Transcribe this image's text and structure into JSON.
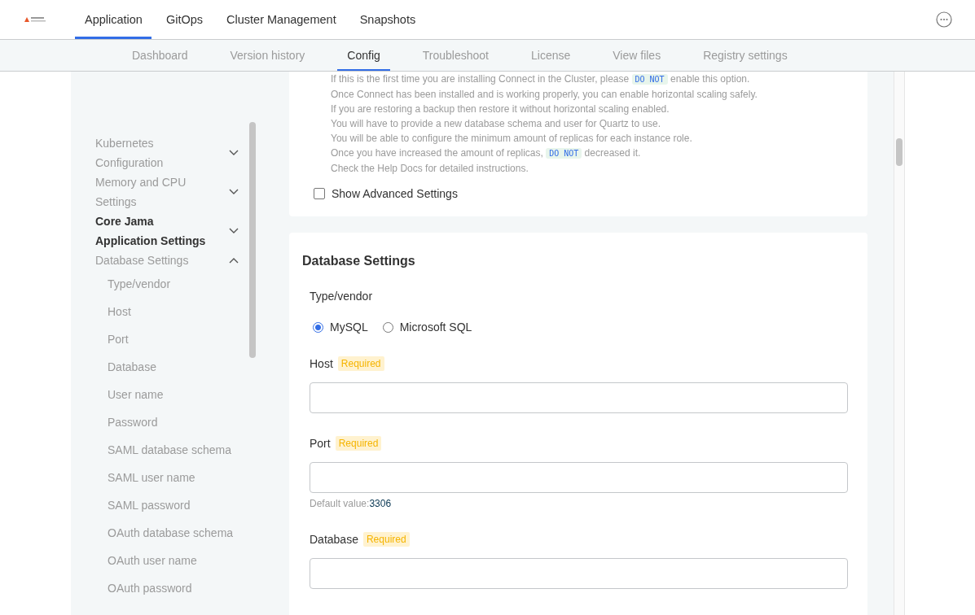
{
  "top_nav": {
    "tabs": [
      {
        "label": "Application",
        "selected": true
      },
      {
        "label": "GitOps",
        "selected": false
      },
      {
        "label": "Cluster Management",
        "selected": false
      },
      {
        "label": "Snapshots",
        "selected": false
      }
    ]
  },
  "sub_nav": {
    "tabs": [
      {
        "label": "Dashboard",
        "selected": false
      },
      {
        "label": "Version history",
        "selected": false
      },
      {
        "label": "Config",
        "selected": true
      },
      {
        "label": "Troubleshoot",
        "selected": false
      },
      {
        "label": "License",
        "selected": false
      },
      {
        "label": "View files",
        "selected": false
      },
      {
        "label": "Registry settings",
        "selected": false
      }
    ]
  },
  "sidebar": {
    "items": [
      {
        "label": "Kubernetes Configuration",
        "selected": false,
        "expanded": false
      },
      {
        "label": "Memory and CPU Settings",
        "selected": false,
        "expanded": false
      },
      {
        "label": "Core Jama Application Settings",
        "selected": true,
        "expanded": false
      },
      {
        "label": "Database Settings",
        "selected": false,
        "expanded": true,
        "children": [
          {
            "label": "Type/vendor"
          },
          {
            "label": "Host"
          },
          {
            "label": "Port"
          },
          {
            "label": "Database"
          },
          {
            "label": "User name"
          },
          {
            "label": "Password"
          },
          {
            "label": "SAML database schema"
          },
          {
            "label": "SAML user name"
          },
          {
            "label": "SAML password"
          },
          {
            "label": "OAuth database schema"
          },
          {
            "label": "OAuth user name"
          },
          {
            "label": "OAuth password"
          }
        ]
      }
    ]
  },
  "notes": [
    [
      {
        "kind": "text",
        "text": "If this is the first time you are installing Connect in the Cluster, please "
      },
      {
        "kind": "code",
        "text": "DO NOT"
      },
      {
        "kind": "text",
        "text": " enable this option."
      }
    ],
    [
      {
        "kind": "text",
        "text": "Once Connect has been installed and is working properly, you can enable horizontal scaling safely."
      }
    ],
    [
      {
        "kind": "text",
        "text": "If you are restoring a backup then restore it without horizontal scaling enabled."
      }
    ],
    [
      {
        "kind": "text",
        "text": "You will have to provide a new database schema and user for Quartz to use."
      }
    ],
    [
      {
        "kind": "text",
        "text": "You will be able to configure the minimum amount of replicas for each instance role."
      }
    ],
    [
      {
        "kind": "text",
        "text": "Once you have increased the amount of replicas, "
      },
      {
        "kind": "code",
        "text": "DO NOT"
      },
      {
        "kind": "text",
        "text": " decreased it."
      }
    ],
    [
      {
        "kind": "text",
        "text": "Check the Help Docs for detailed instructions."
      }
    ]
  ],
  "advanced": {
    "label": "Show Advanced Settings",
    "checked": false
  },
  "database_settings": {
    "title": "Database Settings",
    "type_vendor": {
      "label": "Type/vendor",
      "options": [
        {
          "label": "MySQL",
          "selected": true
        },
        {
          "label": "Microsoft SQL",
          "selected": false
        }
      ]
    },
    "fields": [
      {
        "label": "Host",
        "badge": "Required"
      },
      {
        "label": "Port",
        "badge": "Required",
        "hint_label": "Default value:",
        "hint_value": "3306"
      },
      {
        "label": "Database",
        "badge": "Required"
      }
    ]
  }
}
